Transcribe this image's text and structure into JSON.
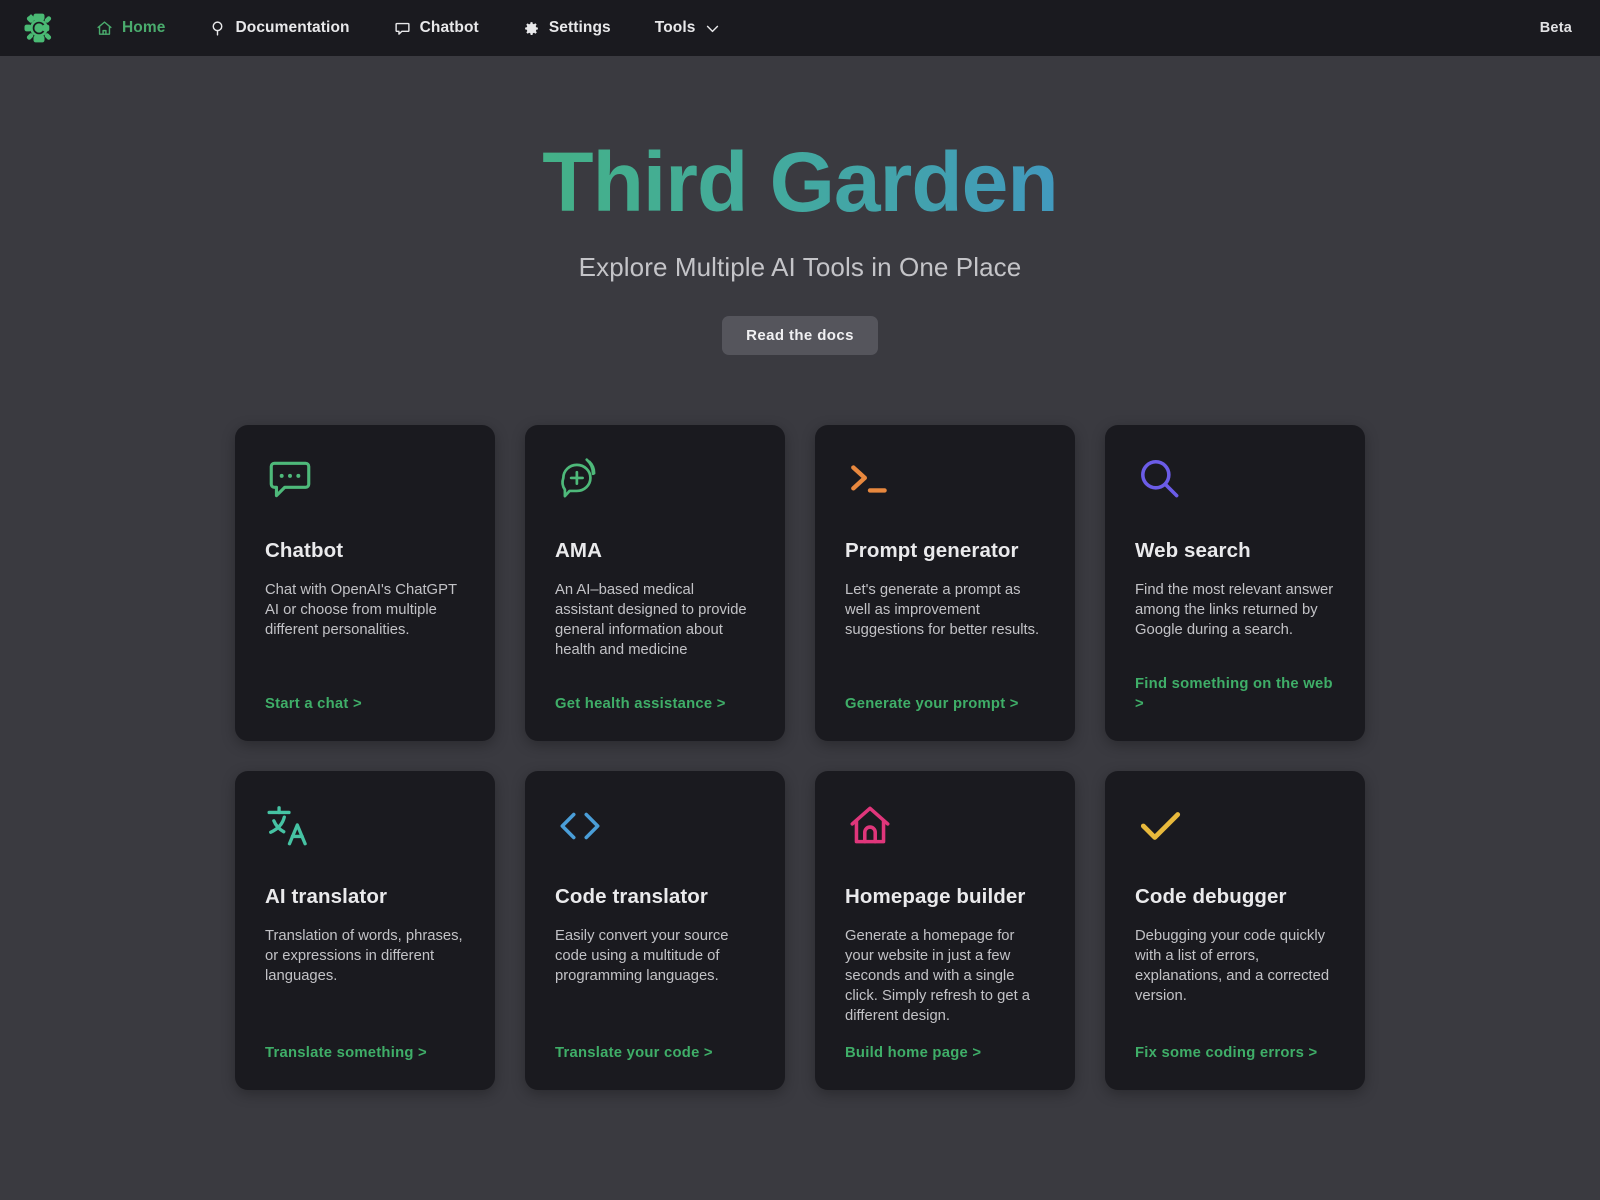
{
  "navbar": {
    "logo_name": "third-garden-logo",
    "items": [
      {
        "label": "Home",
        "icon": "home-icon",
        "active": true
      },
      {
        "label": "Documentation",
        "icon": "bulb-icon",
        "active": false
      },
      {
        "label": "Chatbot",
        "icon": "chat-icon",
        "active": false
      },
      {
        "label": "Settings",
        "icon": "gear-icon",
        "active": false
      },
      {
        "label": "Tools",
        "icon": "chevron-down-icon",
        "active": false
      }
    ],
    "beta_label": "Beta"
  },
  "hero": {
    "title": "Third Garden",
    "subtitle": "Explore Multiple AI Tools in One Place",
    "button_label": "Read the docs"
  },
  "colors": {
    "page_bg": "#3a3a40",
    "card_bg": "#1a1a1f",
    "nav_bg": "#1a1a1f",
    "accent_green": "#3fae68",
    "title_gradient_start": "#4ec06f",
    "title_gradient_end": "#4a8fe0",
    "icon_green": "#4eb97a",
    "icon_orange": "#e8883e",
    "icon_purple": "#6b5ce7",
    "icon_teal": "#46c3a3",
    "icon_blue": "#4a9ed8",
    "icon_pink": "#e0367b",
    "icon_yellow": "#e8b93c"
  },
  "cards": [
    {
      "icon": "chat-bubble-dots-icon",
      "icon_color": "#4eb97a",
      "title": "Chatbot",
      "description": "Chat with OpenAI's ChatGPT AI or choose from multiple different personalities.",
      "link": "Start a chat >"
    },
    {
      "icon": "medical-chat-icon",
      "icon_color": "#4eb97a",
      "title": "AMA",
      "description": "An AI–based medical assistant designed to provide general information about health and medicine",
      "link": "Get health assistance >"
    },
    {
      "icon": "terminal-prompt-icon",
      "icon_color": "#e8883e",
      "title": "Prompt generator",
      "description": "Let's generate a prompt as well as improvement suggestions for better results.",
      "link": "Generate your prompt >"
    },
    {
      "icon": "magnifier-icon",
      "icon_color": "#6b5ce7",
      "title": "Web search",
      "description": "Find the most relevant answer among the links returned by Google during a search.",
      "link": "Find something on the web >"
    },
    {
      "icon": "translate-icon",
      "icon_color": "#46c3a3",
      "title": "AI translator",
      "description": "Translation of words, phrases, or expressions in different languages.",
      "link": "Translate something >"
    },
    {
      "icon": "code-brackets-icon",
      "icon_color": "#4a9ed8",
      "title": "Code translator",
      "description": "Easily convert your source code using a multitude of programming languages.",
      "link": "Translate your code >"
    },
    {
      "icon": "house-icon",
      "icon_color": "#e0367b",
      "title": "Homepage builder",
      "description": "Generate a homepage for your website in just a few seconds and with a single click. Simply refresh to get a different design.",
      "link": "Build home page >"
    },
    {
      "icon": "checkmark-icon",
      "icon_color": "#e8b93c",
      "title": "Code debugger",
      "description": "Debugging your code quickly with a list of errors, explanations, and a corrected version.",
      "link": "Fix some coding errors >"
    }
  ]
}
